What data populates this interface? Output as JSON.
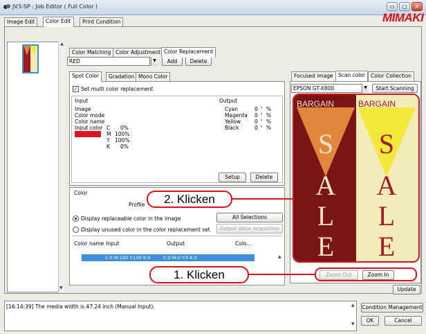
{
  "window": {
    "title": "JV3-SP : Job Editor ( Full Color )",
    "brand": "MIMAKI",
    "min_glyph": "▭",
    "max_glyph": "▢",
    "close_glyph": "✕"
  },
  "main_tabs": [
    "Image Edit",
    "Color Edit",
    "Print Condition"
  ],
  "color_tabs": [
    "Color Matching",
    "Color Adjustment",
    "Color Replacement"
  ],
  "replacement": {
    "set_value": "RED",
    "add_label": "Add",
    "delete_label": "Delete"
  },
  "sub_tabs": [
    "Spot Color",
    "Gradation",
    "Mono Color"
  ],
  "multi_replace": {
    "checked": true,
    "label": "Set multi color replacement"
  },
  "input": {
    "heading": "Input",
    "image_label": "Image",
    "color_mode_label": "Color mode",
    "color_name_label": "Color name",
    "input_color_label": "Input color",
    "swatch_color": "#e0141c",
    "channels": [
      {
        "name": "C",
        "value": "0%"
      },
      {
        "name": "M",
        "value": "100%"
      },
      {
        "name": "Y",
        "value": "100%"
      },
      {
        "name": "K",
        "value": "0%"
      }
    ]
  },
  "output": {
    "heading": "Output",
    "unit": "%",
    "rows": [
      {
        "name": "Cyan",
        "value": "0"
      },
      {
        "name": "Magenta",
        "value": "0"
      },
      {
        "name": "Yellow",
        "value": "0"
      },
      {
        "name": "Black",
        "value": "0"
      }
    ],
    "setup_label": "Setup",
    "delete_label": "Delete"
  },
  "color_section": {
    "heading": "Color",
    "profile_label": "Profile",
    "options": [
      {
        "label": "Display replaceable color in the image",
        "selected": true
      },
      {
        "label": "Display unused color in the color replacement set",
        "selected": false
      }
    ],
    "all_selections_label": "All Selections",
    "output_value_label": "Output Value Acquisition",
    "columns": [
      "Color name",
      "Input",
      "Output",
      "Colo..."
    ],
    "row": {
      "input": "C:0 M:100 Y:100 K:0",
      "output": "C:0 M:0 Y:0 K:0"
    }
  },
  "right_tabs": [
    "Focused image",
    "Scan color",
    "Color Collection"
  ],
  "scanner": {
    "device": "EPSON GT-X800",
    "start_label": "Start Scanning"
  },
  "preview": {
    "left_banner": "BARGAIN",
    "right_banner": "BARGAIN",
    "letters": [
      "S",
      "A",
      "L",
      "E"
    ]
  },
  "zoom": {
    "zoom_out_label": "Zoom Out",
    "zoom_in_label": "Zoom In"
  },
  "update_label": "Update",
  "log_message": "[16:14:39] The media width is 47.24 inch (Manual Input).",
  "footer": {
    "condition_label": "Condition Management",
    "ok_label": "OK",
    "cancel_label": "Cancel"
  },
  "callouts": {
    "step2": "2. Klicken",
    "step1": "1. Klicken"
  },
  "colors": {
    "accent_red": "#d8101a",
    "selection_blue": "#3d8fe0"
  }
}
